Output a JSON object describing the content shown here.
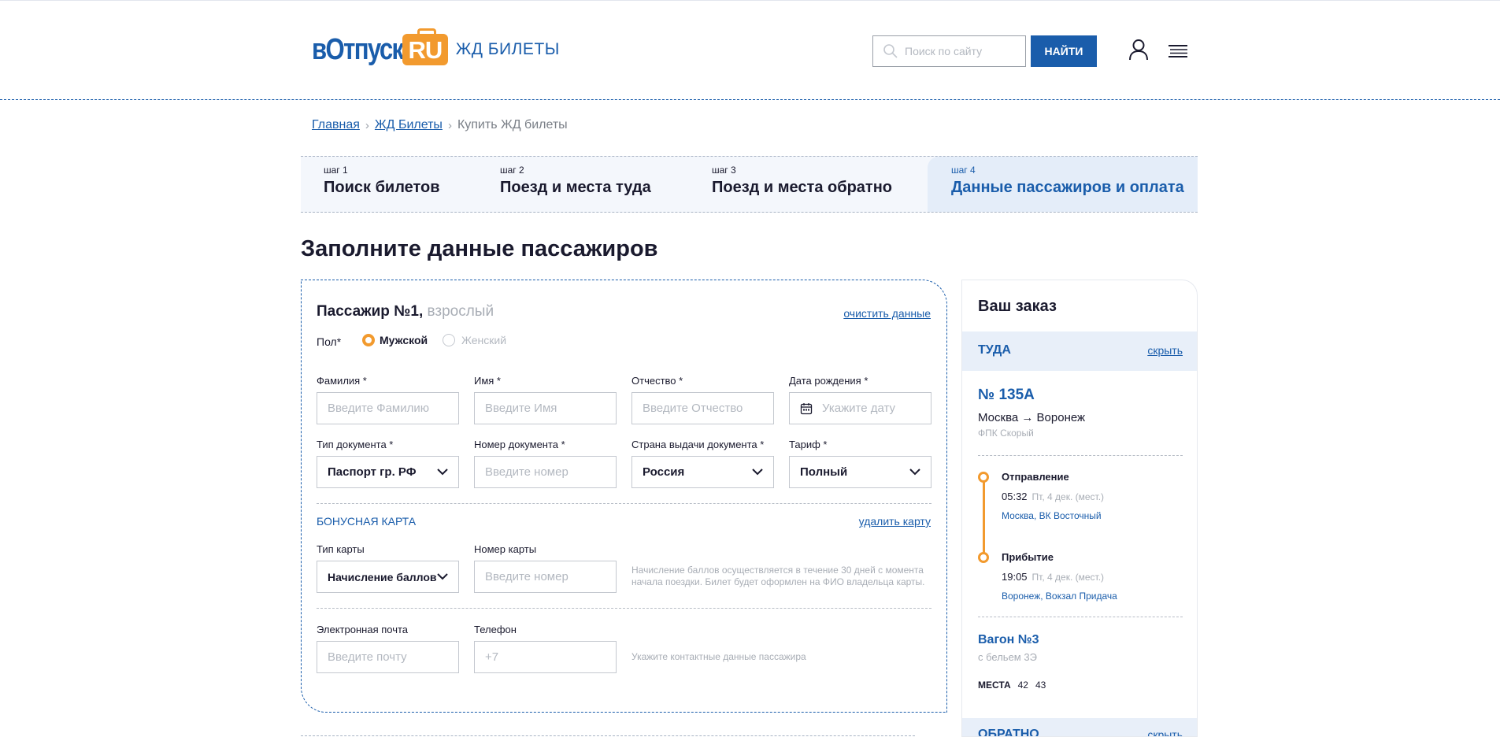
{
  "header": {
    "logo_word": "вОтпуск",
    "logo_bag": "RU",
    "logo_sub": "ЖД БИЛЕТЫ",
    "search_placeholder": "Поиск по сайту",
    "search_button": "НАЙТИ"
  },
  "breadcrumb": {
    "items": [
      "Главная",
      "ЖД Билеты"
    ],
    "current": "Купить ЖД билеты"
  },
  "steps": [
    {
      "num": "шаг 1",
      "title": "Поиск билетов",
      "active": false
    },
    {
      "num": "шаг 2",
      "title": "Поезд и места туда",
      "active": false
    },
    {
      "num": "шаг 3",
      "title": "Поезд и места обратно",
      "active": false
    },
    {
      "num": "шаг 4",
      "title": "Данные пассажиров и оплата",
      "active": true
    }
  ],
  "page_title": "Заполните данные пассажиров",
  "passenger": {
    "title": "Пассажир №1,",
    "type": "взрослый",
    "clear_link": "очистить данные",
    "gender_label": "Пол*",
    "gender_options": [
      "Мужской",
      "Женский"
    ],
    "gender_selected": "Мужской",
    "fields": {
      "surname": {
        "label": "Фамилия *",
        "placeholder": "Введите Фамилию"
      },
      "name": {
        "label": "Имя *",
        "placeholder": "Введите Имя"
      },
      "patronymic": {
        "label": "Отчество *",
        "placeholder": "Введите Отчество"
      },
      "birthdate": {
        "label": "Дата рождения *",
        "placeholder": "Укажите дату"
      },
      "doc_type": {
        "label": "Тип документа *",
        "value": "Паспорт гр. РФ"
      },
      "doc_number": {
        "label": "Номер документа *",
        "placeholder": "Введите номер"
      },
      "doc_country": {
        "label": "Страна выдачи документа *",
        "value": "Россия"
      },
      "tariff": {
        "label": "Тариф *",
        "value": "Полный"
      }
    },
    "bonus": {
      "title": "БОНУСНАЯ КАРТА",
      "delete_link": "удалить карту",
      "card_type_label": "Тип карты",
      "card_type_value": "Начисление баллов",
      "card_number_label": "Номер карты",
      "card_number_placeholder": "Введите номер",
      "hint": "Начисление баллов осуществляется в течение 30 дней с момента начала поездки. Билет будет оформлен на ФИО владельца карты."
    },
    "contacts": {
      "email_label": "Электронная почта",
      "email_placeholder": "Введите почту",
      "phone_label": "Телефон",
      "phone_placeholder": "+7",
      "hint": "Укажите контактные данные пассажира"
    }
  },
  "order": {
    "title": "Ваш заказ",
    "direction": "ТУДА",
    "hide_link": "скрыть",
    "train_no": "№ 135А",
    "route": "Москва → Воронеж",
    "carrier": "ФПК Скорый",
    "departure": {
      "title": "Отправление",
      "time": "05:32",
      "date": "Пт, 4 дек. (мест.)",
      "place": "Москва, ВК Восточный"
    },
    "arrival": {
      "title": "Прибытие",
      "time": "19:05",
      "date": "Пт, 4 дек. (мест.)",
      "place": "Воронеж, Вокзал Придача"
    },
    "wagon": "Вагон №3",
    "wagon_class": "с бельем 3Э",
    "seats_label": "МЕСТА",
    "seats": [
      "42",
      "43"
    ],
    "direction_back": "ОБРАТНО",
    "hide_link_back": "скрыть"
  },
  "colors": {
    "accent": "#1a5dab",
    "orange": "#f29a2e",
    "step_bg": "#f4f7fc"
  }
}
